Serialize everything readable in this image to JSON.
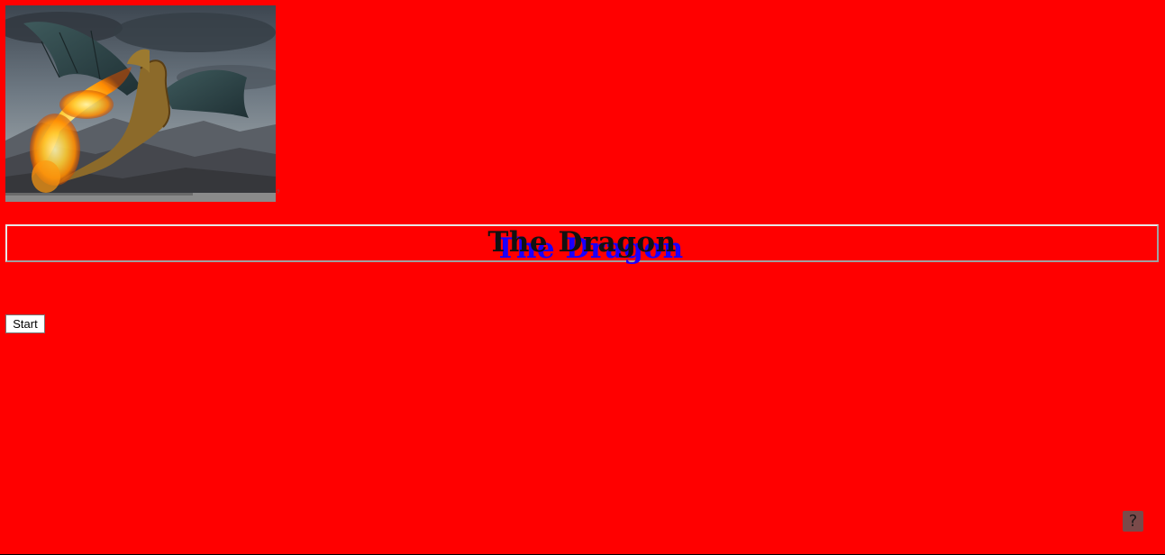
{
  "hero": {
    "image": "dragon-breathing-fire-illustration",
    "mark": "?"
  },
  "title": {
    "text": "The Dragon",
    "shadow_text": "The Dragon",
    "shadow_color": "#1a00ff"
  },
  "start_button": {
    "label": "Start"
  },
  "help_button": {
    "label": "?",
    "icon": "help-icon"
  },
  "colors": {
    "background": "#ff0000"
  }
}
